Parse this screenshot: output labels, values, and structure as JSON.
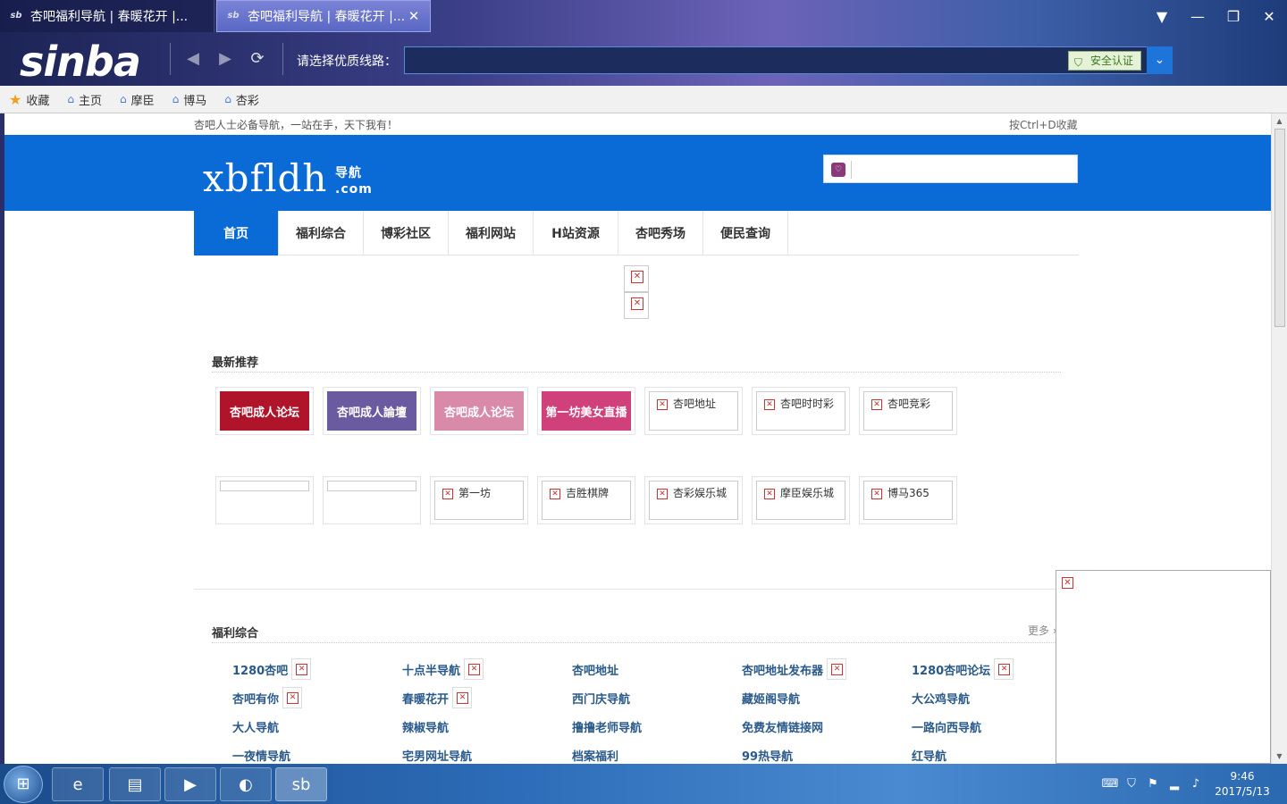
{
  "browser": {
    "tabs": [
      {
        "title": "杏吧福利导航 | 春暖花开 |...",
        "active": false
      },
      {
        "title": "杏吧福利导航 | 春暖花开 |...",
        "active": true
      }
    ],
    "logo": "sinba",
    "address_label": "请选择优质线路：",
    "address_value": "",
    "secure_label": "安全认证",
    "bookmarks": [
      {
        "label": "收藏",
        "icon": "star-icon"
      },
      {
        "label": "主页",
        "icon": "home-icon"
      },
      {
        "label": "摩臣",
        "icon": "home-icon"
      },
      {
        "label": "博马",
        "icon": "home-icon"
      },
      {
        "label": "杏彩",
        "icon": "home-icon"
      }
    ]
  },
  "page": {
    "top_slogan": "杏吧人士必备导航，一站在手，天下我有！",
    "bookmark_hint": "按Ctrl+D收藏",
    "site_logo": "xbfldh",
    "site_logo_sub1": "导航",
    "site_logo_sub2": ".com",
    "nav": [
      "首页",
      "福利综合",
      "博彩社区",
      "福利网站",
      "H站资源",
      "杏吧秀场",
      "便民查询"
    ],
    "latest": {
      "title": "最新推荐",
      "row1": [
        {
          "type": "image",
          "label": "杏吧成人论坛",
          "color": "#b0142a"
        },
        {
          "type": "image",
          "label": "杏吧成人論壇",
          "color": "#6a5aa0"
        },
        {
          "type": "image",
          "label": "杏吧成人论坛",
          "color": "#d88aa8"
        },
        {
          "type": "image",
          "label": "第一坊美女直播",
          "color": "#d0407a"
        },
        {
          "type": "text",
          "label": "杏吧地址"
        },
        {
          "type": "text",
          "label": "杏吧时时彩"
        },
        {
          "type": "text",
          "label": "杏吧竞彩"
        }
      ],
      "row2": [
        {
          "type": "blank",
          "label": ""
        },
        {
          "type": "blank",
          "label": ""
        },
        {
          "type": "text",
          "label": "第一坊"
        },
        {
          "type": "text",
          "label": "吉胜棋牌"
        },
        {
          "type": "text",
          "label": "杏彩娱乐城"
        },
        {
          "type": "text",
          "label": "摩臣娱乐城"
        },
        {
          "type": "text",
          "label": "博马365"
        }
      ]
    },
    "welfare": {
      "title": "福利综合",
      "more": "更多",
      "rows": [
        [
          {
            "label": "1280杏吧",
            "broken": true
          },
          {
            "label": "十点半导航",
            "broken": true
          },
          {
            "label": "杏吧地址",
            "broken": false
          },
          {
            "label": "杏吧地址发布器",
            "broken": true
          },
          {
            "label": "1280杏吧论坛",
            "broken": true
          }
        ],
        [
          {
            "label": "杏吧有你",
            "broken": true
          },
          {
            "label": "春暖花开",
            "broken": true
          },
          {
            "label": "西门庆导航",
            "broken": false
          },
          {
            "label": "藏姬阁导航",
            "broken": false
          },
          {
            "label": "大公鸡导航",
            "broken": false
          }
        ],
        [
          {
            "label": "大人导航",
            "broken": false
          },
          {
            "label": "辣椒导航",
            "broken": false
          },
          {
            "label": "撸撸老师导航",
            "broken": false
          },
          {
            "label": "免费友情链接网",
            "broken": false
          },
          {
            "label": "一路向西导航",
            "broken": false
          }
        ],
        [
          {
            "label": "一夜情导航",
            "broken": false
          },
          {
            "label": "宅男网址导航",
            "broken": false
          },
          {
            "label": "档案福利",
            "broken": false
          },
          {
            "label": "99热导航",
            "broken": false
          },
          {
            "label": "红导航",
            "broken": false
          }
        ]
      ]
    }
  },
  "taskbar": {
    "time": "9:46",
    "date": "2017/5/13"
  }
}
